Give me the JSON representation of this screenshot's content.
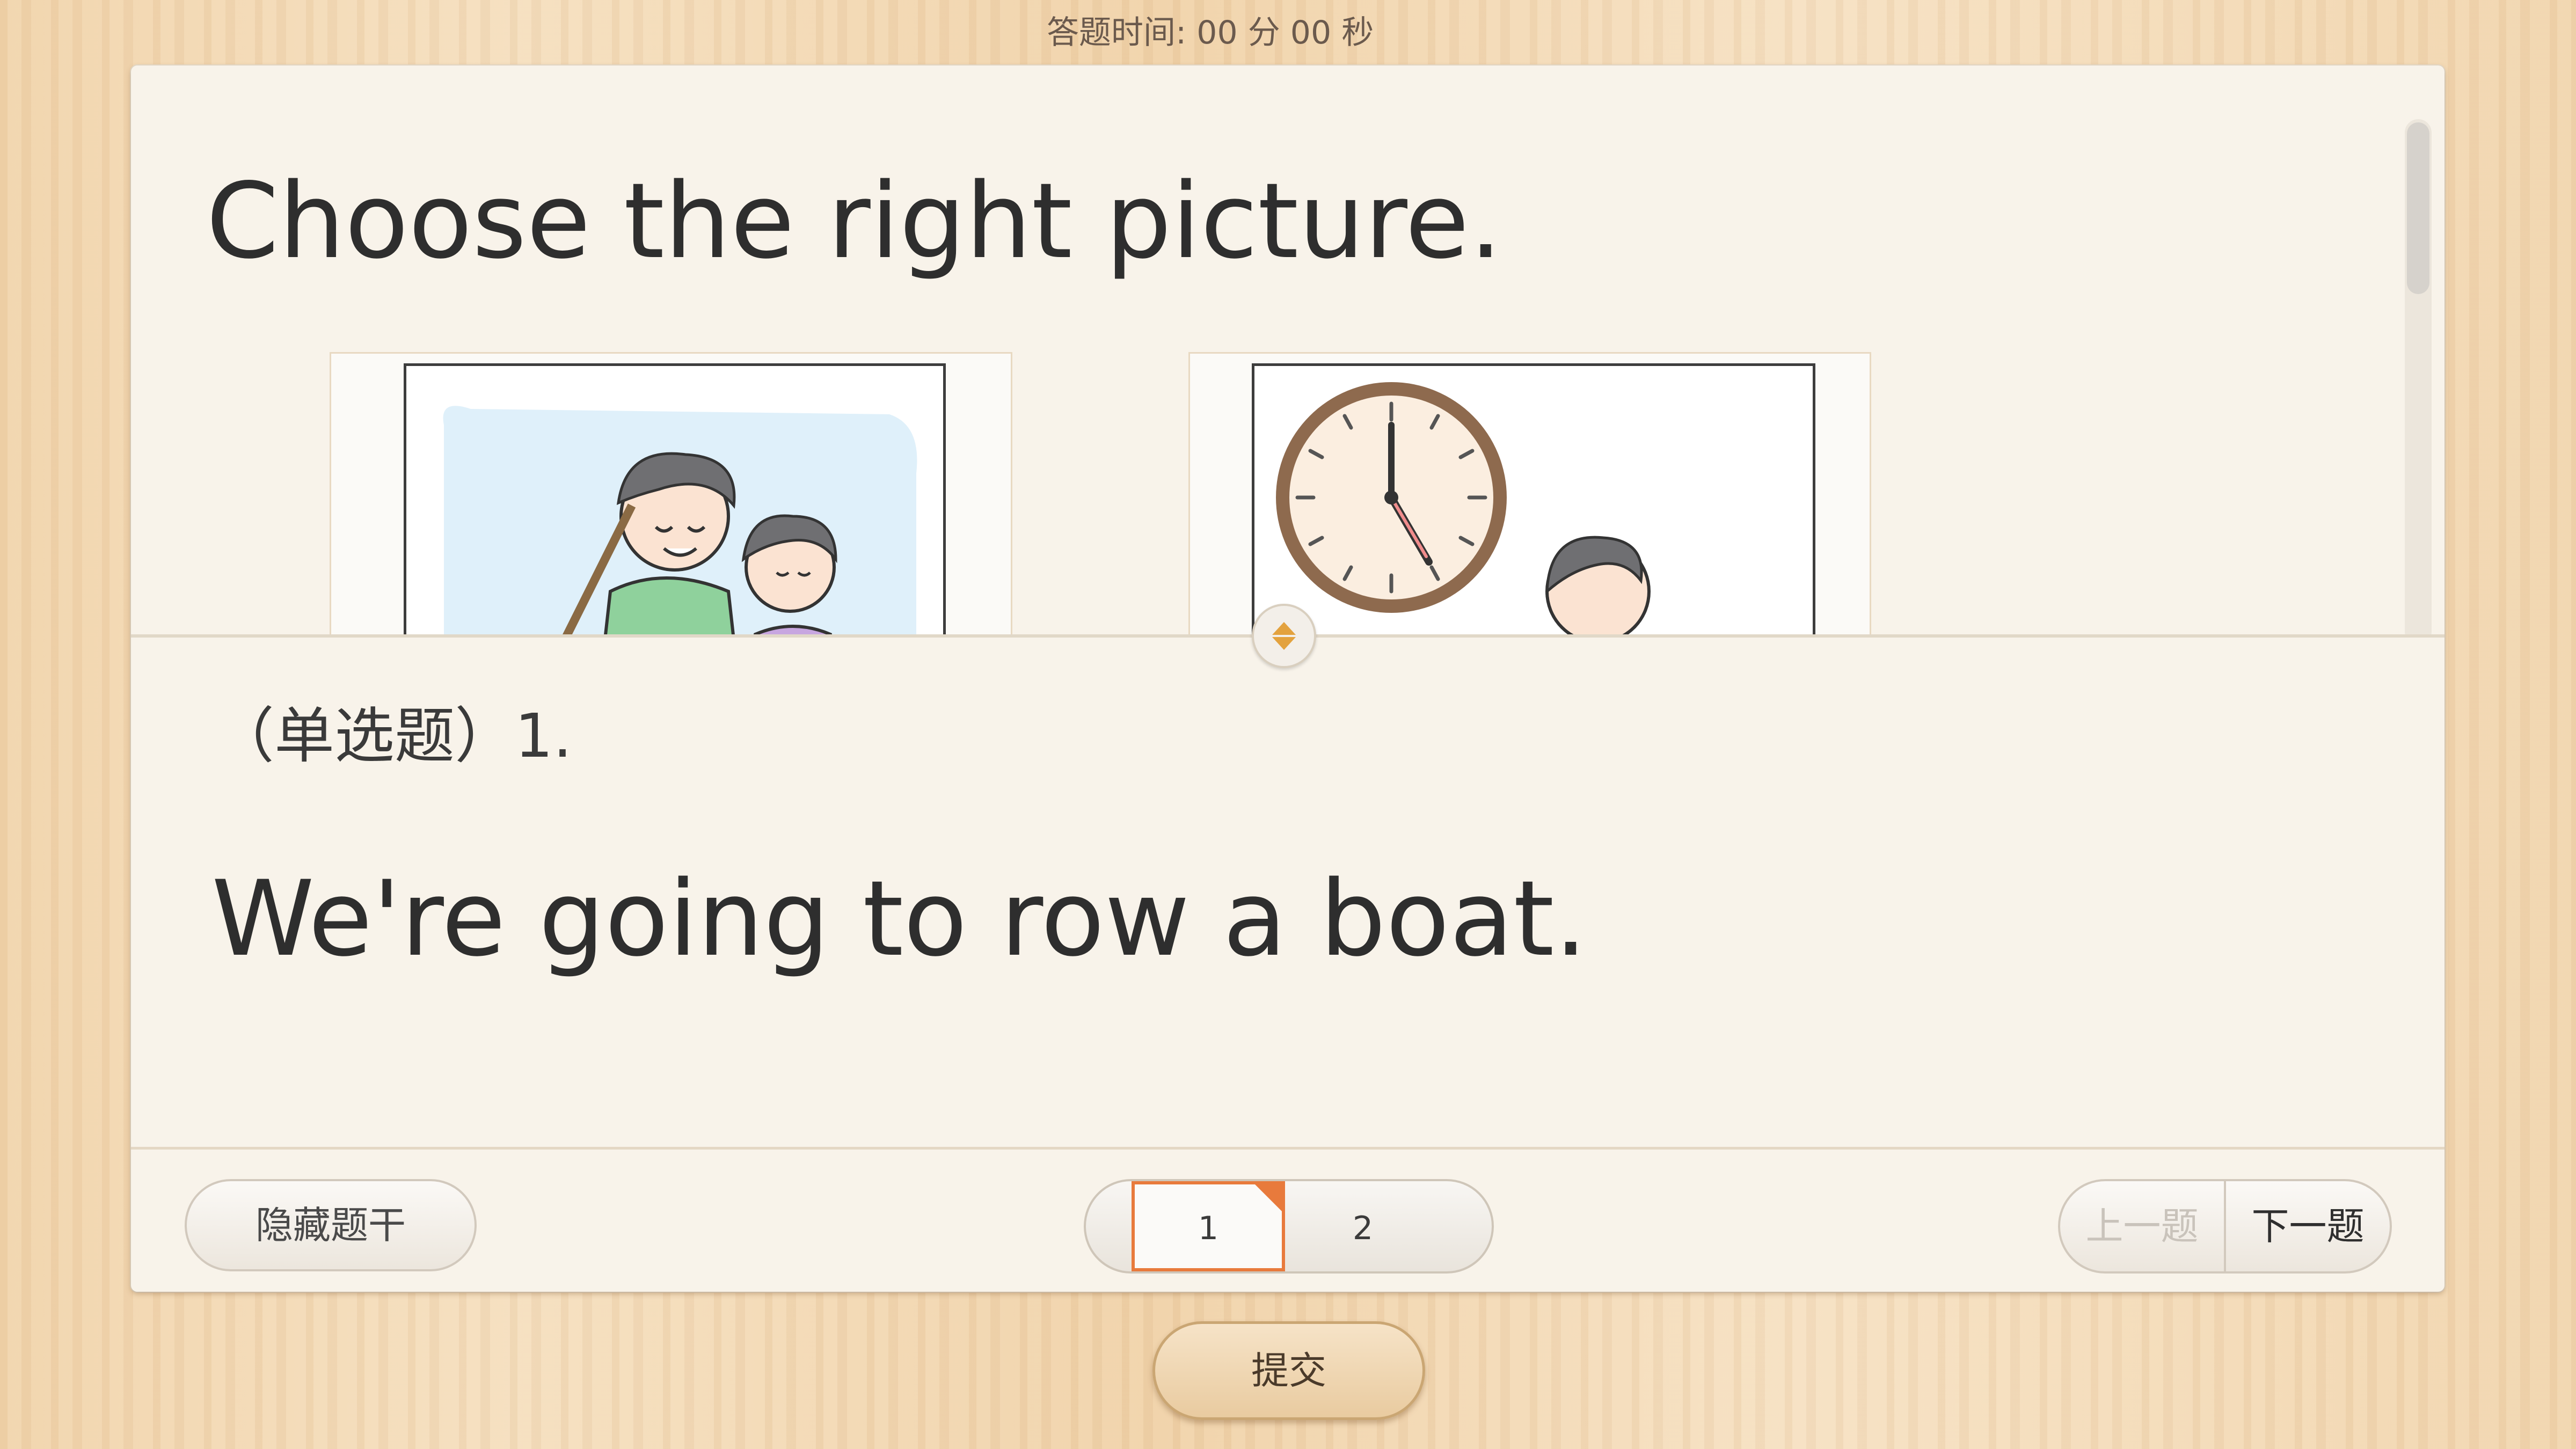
{
  "timer": {
    "label": "答题时间:",
    "value": "00 分 00 秒"
  },
  "stem": {
    "instruction": "Choose the right picture.",
    "pictures": [
      {
        "icon": "boat-rowing-picture"
      },
      {
        "icon": "clock-five-oclock-picture"
      }
    ]
  },
  "question": {
    "type_label": "（单选题）1.",
    "text": "We're going to row a boat."
  },
  "toolbar": {
    "hide_stem_label": "隐藏题干",
    "pages": [
      "1",
      "2"
    ],
    "current_page": "1",
    "prev_label": "上一题",
    "next_label": "下一题"
  },
  "submit_label": "提交",
  "colors": {
    "accent": "#e87a3c",
    "panel": "#f8f3ea"
  }
}
